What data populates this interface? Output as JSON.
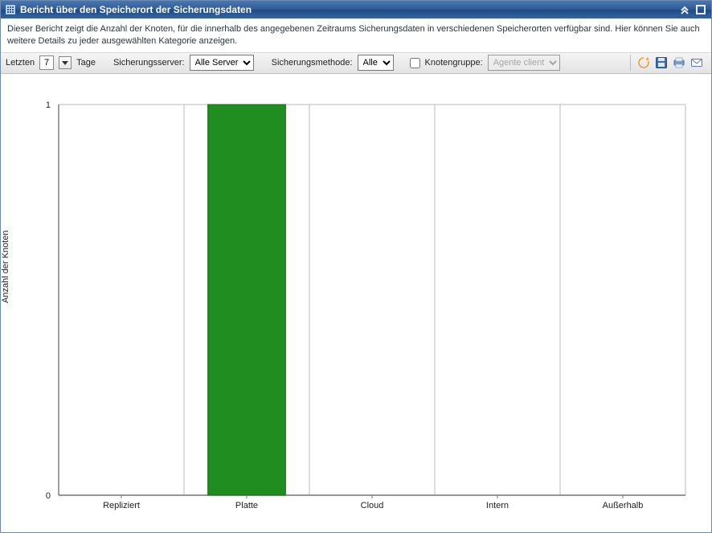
{
  "window": {
    "title": "Bericht über den Speicherort der Sicherungsdaten"
  },
  "description": "Dieser Bericht zeigt die Anzahl der Knoten, für die innerhalb des angegebenen Zeitraums Sicherungsdaten in verschiedenen Speicherorten verfügbar sind. Hier können Sie auch weitere Details zu jeder ausgewählten Kategorie anzeigen.",
  "toolbar": {
    "last_label": "Letzten",
    "last_value": "7",
    "days_label": "Tage",
    "server_label": "Sicherungsserver:",
    "server_value": "Alle Server",
    "method_label": "Sicherungsmethode:",
    "method_value": "Alle",
    "group_label": "Knotengruppe:",
    "group_value": "Agente client"
  },
  "chart_data": {
    "type": "bar",
    "categories": [
      "Repliziert",
      "Platte",
      "Cloud",
      "Intern",
      "Außerhalb"
    ],
    "values": [
      0,
      1,
      0,
      0,
      0
    ],
    "ylabel": "Anzahl der Knoten",
    "ylim": [
      0,
      1
    ],
    "yticks": [
      0,
      1
    ],
    "bar_color": "#1f8d1f"
  }
}
